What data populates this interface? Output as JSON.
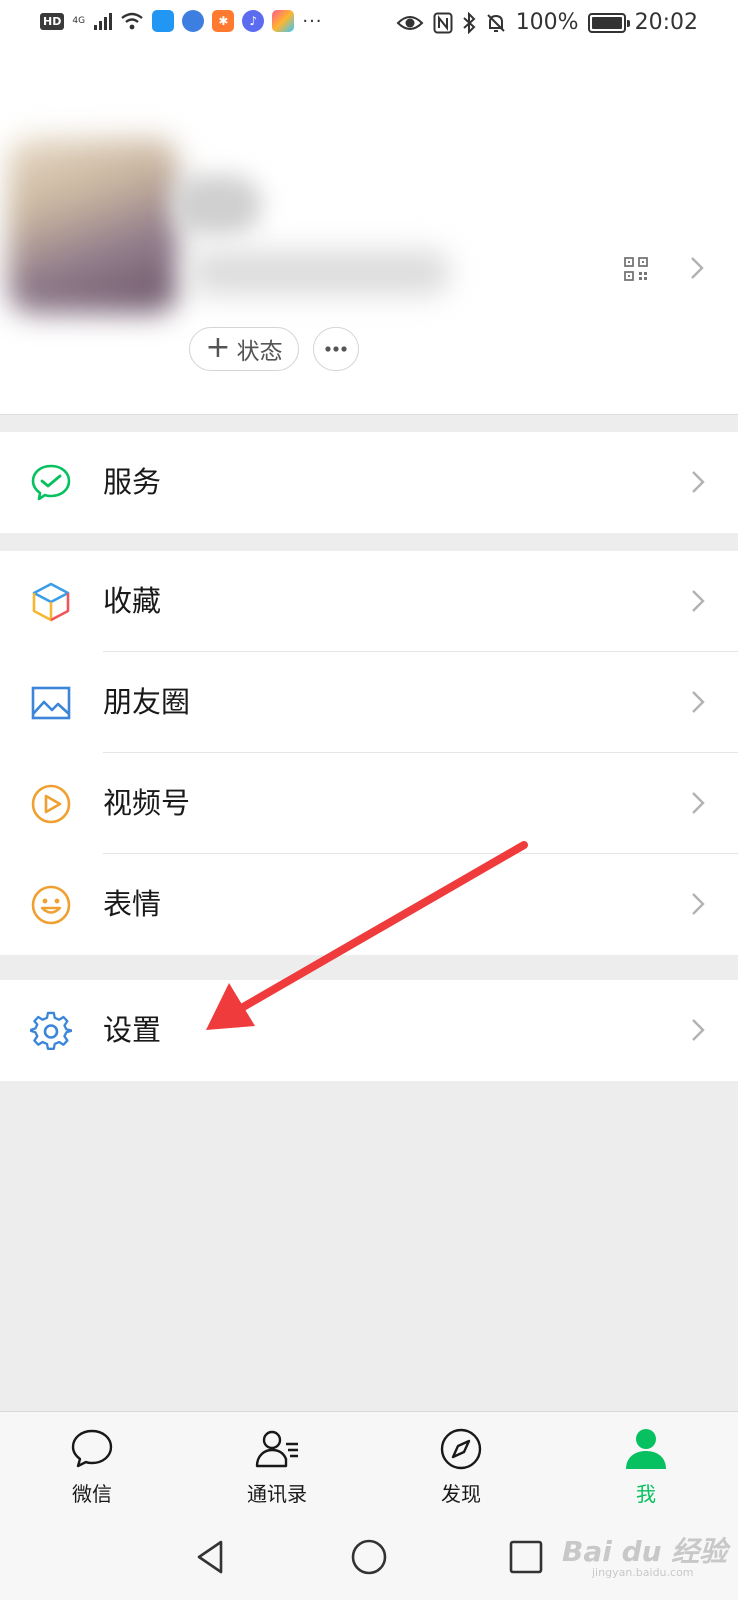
{
  "status_bar": {
    "hd": "HD",
    "network": "4G",
    "battery": "100%",
    "time": "20:02",
    "more": "···"
  },
  "profile": {
    "status_button": "状态",
    "more_button": "···"
  },
  "menu": {
    "groups": [
      [
        {
          "label": "服务",
          "icon": "wechat-pay-icon"
        }
      ],
      [
        {
          "label": "收藏",
          "icon": "favorites-cube-icon"
        },
        {
          "label": "朋友圈",
          "icon": "moments-image-icon"
        },
        {
          "label": "视频号",
          "icon": "channels-play-icon"
        },
        {
          "label": "表情",
          "icon": "sticker-smile-icon"
        }
      ],
      [
        {
          "label": "设置",
          "icon": "settings-gear-icon"
        }
      ]
    ]
  },
  "tabs": [
    {
      "label": "微信",
      "icon": "chat-bubble-icon",
      "active": false
    },
    {
      "label": "通讯录",
      "icon": "contacts-icon",
      "active": false
    },
    {
      "label": "发现",
      "icon": "compass-icon",
      "active": false
    },
    {
      "label": "我",
      "icon": "me-person-icon",
      "active": true
    }
  ],
  "watermark": {
    "brand": "Bai du 经验",
    "url": "jingyan.baidu.com"
  },
  "colors": {
    "accent": "#07c160",
    "annotation": "#ef3b3b",
    "background": "#ededed"
  }
}
